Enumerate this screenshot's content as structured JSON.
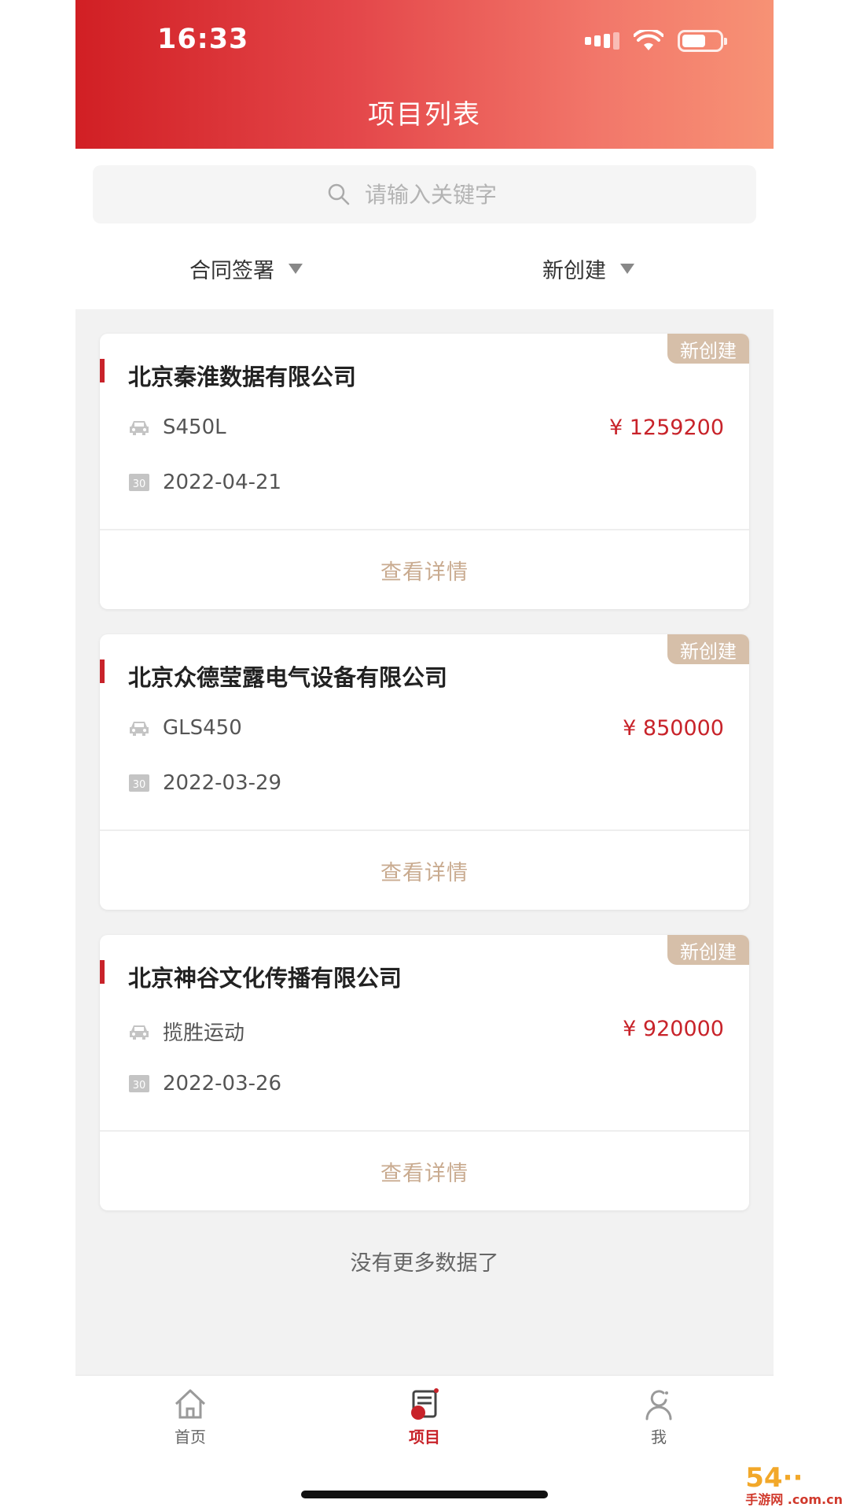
{
  "status_bar": {
    "time": "16:33"
  },
  "header": {
    "title": "项目列表"
  },
  "search": {
    "placeholder": "请输入关键字"
  },
  "filters": [
    {
      "label": "合同签署"
    },
    {
      "label": "新创建"
    }
  ],
  "projects": [
    {
      "badge": "新创建",
      "company": "北京秦淮数据有限公司",
      "model": "S450L",
      "price": "¥ 1259200",
      "date": "2022-04-21",
      "detail": "查看详情"
    },
    {
      "badge": "新创建",
      "company": "北京众德莹露电气设备有限公司",
      "model": "GLS450",
      "price": "¥ 850000",
      "date": "2022-03-29",
      "detail": "查看详情"
    },
    {
      "badge": "新创建",
      "company": "北京神谷文化传播有限公司",
      "model": "揽胜运动",
      "price": "¥ 920000",
      "date": "2022-03-26",
      "detail": "查看详情"
    }
  ],
  "list_footer": "没有更多数据了",
  "tabbar": {
    "items": [
      {
        "label": "首页",
        "icon": "home-icon",
        "active": false
      },
      {
        "label": "项目",
        "icon": "project-icon",
        "active": true
      },
      {
        "label": "我",
        "icon": "user-icon",
        "active": false
      }
    ]
  },
  "watermark": {
    "text": "54··",
    "sub": "手游网 .com.cn"
  },
  "colors": {
    "brand_red": "#c8232a",
    "badge_tan": "#d6bfa9",
    "link_tan": "#c9ab90"
  }
}
